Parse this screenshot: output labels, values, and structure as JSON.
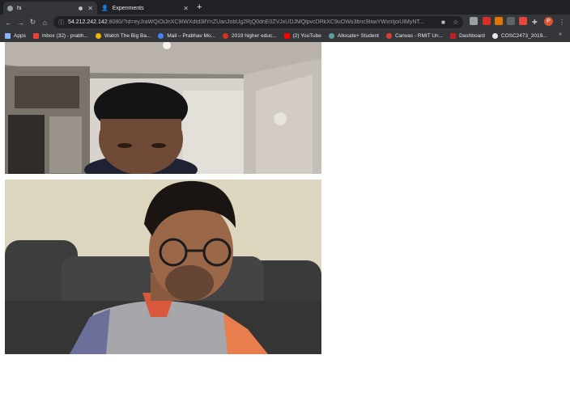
{
  "tabs": [
    {
      "title": "hi",
      "active": true
    },
    {
      "title": "Experiments",
      "active": false
    }
  ],
  "newtab_label": "+",
  "address": {
    "host": "54.212.242.142",
    "path": ":8080/?id=eyJraWQiOiJnXC9IWXdtd3llYnZUanJobUg2RjQ0dnE0ZVJxUDJMQlpvcDRkXC9uOWo3bnc9IiwiYWxnIjoiUlMyNT..."
  },
  "bookmarks": [
    {
      "label": "Apps",
      "color": "#8ab4f8"
    },
    {
      "label": "Inbox (32) - prabh...",
      "color": "#ea4335"
    },
    {
      "label": "Watch The Big Ba...",
      "color": "#f4b400"
    },
    {
      "label": "Mail – Prabhav Mo...",
      "color": "#4285f4"
    },
    {
      "label": "2019 higher educ...",
      "color": "#d93025"
    },
    {
      "label": "(2) YouTube",
      "color": "#ff0000"
    },
    {
      "label": "Allocate+ Student",
      "color": "#5f9ea0"
    },
    {
      "label": "Canvas - RMIT Un...",
      "color": "#e23a2e"
    },
    {
      "label": "Dashboard",
      "color": "#c5221f"
    },
    {
      "label": "COSC2473_2019...",
      "color": "#e8eaed"
    }
  ],
  "bookmarks_more": "»",
  "extensions": [
    "#9aa0a6",
    "#d93025",
    "#e37400",
    "#5f6368",
    "#e8453c"
  ],
  "profile_initial": "P",
  "videos": [
    {
      "name": "remote-participant-video"
    },
    {
      "name": "local-participant-video"
    }
  ]
}
